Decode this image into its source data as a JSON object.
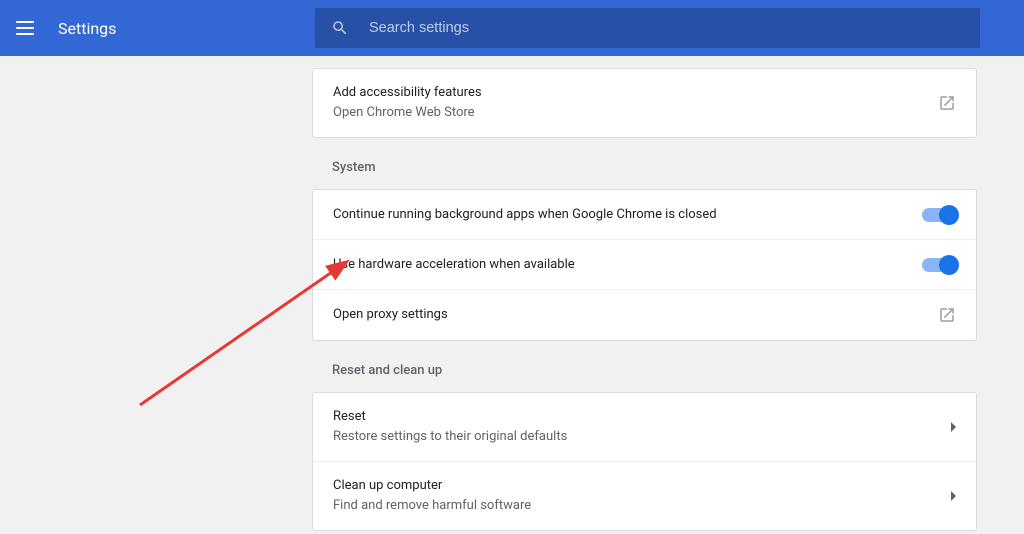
{
  "header": {
    "title": "Settings",
    "search_placeholder": "Search settings"
  },
  "accessibility_card": {
    "title": "Add accessibility features",
    "subtitle": "Open Chrome Web Store"
  },
  "system": {
    "section_title": "System",
    "rows": [
      {
        "label": "Continue running background apps when Google Chrome is closed"
      },
      {
        "label": "Use hardware acceleration when available"
      },
      {
        "label": "Open proxy settings"
      }
    ]
  },
  "reset": {
    "section_title": "Reset and clean up",
    "rows": [
      {
        "title": "Reset",
        "subtitle": "Restore settings to their original defaults"
      },
      {
        "title": "Clean up computer",
        "subtitle": "Find and remove harmful software"
      }
    ]
  }
}
